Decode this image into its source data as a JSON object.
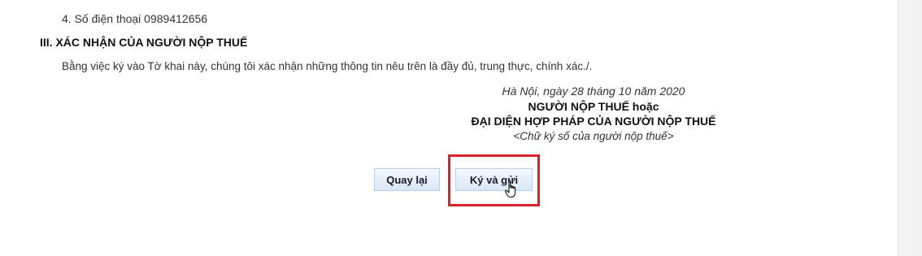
{
  "contact": {
    "phone_line": "4. Số điện thoại 0989412656"
  },
  "confirmation": {
    "section_title": "III. XÁC NHẬN CỦA NGƯỜI NỘP THUẾ",
    "declaration_text": "Bằng việc ký vào Tờ khai này, chúng tôi xác nhận những thông tin nêu trên là đầy đủ, trung thực, chính xác./."
  },
  "signature": {
    "place_date": "Hà Nội, ngày 28 tháng 10 năm 2020",
    "title_line1": "NGƯỜI NỘP THUẾ hoặc",
    "title_line2": "ĐẠI DIỆN HỢP PHÁP CỦA NGƯỜI NỘP THUẾ",
    "note": "<Chữ ký số của người nộp thuế>"
  },
  "actions": {
    "back_label": "Quay lại",
    "sign_submit_label": "Ký và gửi"
  },
  "colors": {
    "highlight": "#d8232a",
    "button_border": "#b9cfe6"
  },
  "icons": {
    "cursor": "hand-pointer-icon"
  }
}
